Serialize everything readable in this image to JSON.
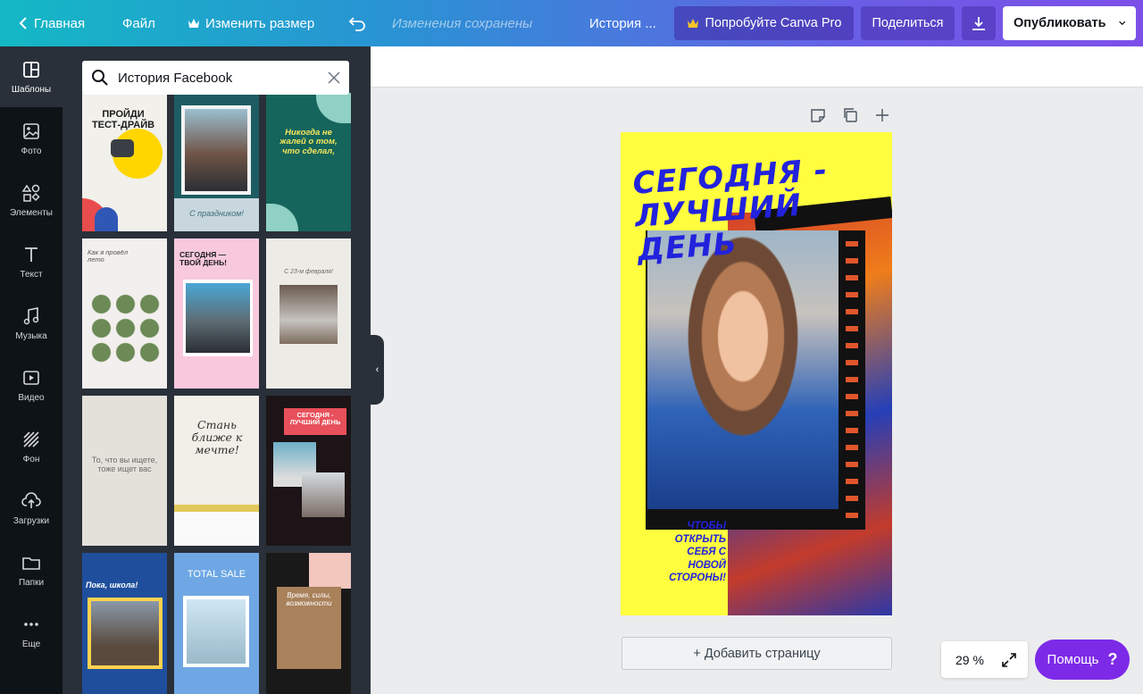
{
  "topbar": {
    "home_label": "Главная",
    "file_label": "Файл",
    "resize_label": "Изменить размер",
    "saved_status": "Изменения сохранены",
    "doc_title": "История ...",
    "pro_label": "Попробуйте Canva Pro",
    "share_label": "Поделиться",
    "publish_label": "Опубликовать"
  },
  "rail": {
    "items": [
      {
        "label": "Шаблоны",
        "icon": "templates-icon"
      },
      {
        "label": "Фото",
        "icon": "photo-icon"
      },
      {
        "label": "Элементы",
        "icon": "elements-icon"
      },
      {
        "label": "Текст",
        "icon": "text-icon"
      },
      {
        "label": "Музыка",
        "icon": "music-icon"
      },
      {
        "label": "Видео",
        "icon": "video-icon"
      },
      {
        "label": "Фон",
        "icon": "background-icon"
      },
      {
        "label": "Загрузки",
        "icon": "upload-icon"
      },
      {
        "label": "Папки",
        "icon": "folder-icon"
      },
      {
        "label": "Еще",
        "icon": "more-icon"
      }
    ]
  },
  "search": {
    "value": "История Facebook"
  },
  "templates": [
    {
      "text": "ПРОЙДИ ТЕСТ-ДРАЙВ"
    },
    {
      "text": "С праздником!"
    },
    {
      "text": "Никогда не жалей о том, что сделал,"
    },
    {
      "text": "Как я провёл лето"
    },
    {
      "text": "СЕГОДНЯ —ТВОЙ ДЕНЬ!"
    },
    {
      "text": "С 23-м февраля!"
    },
    {
      "text": "То, что вы ищете, тоже ищет вас"
    },
    {
      "text": "Стань ближе к мечте!"
    },
    {
      "text": "СЕГОДНЯ - ЛУЧШИЙ ДЕНЬ"
    },
    {
      "text": "Пока, школа!"
    },
    {
      "text": "TOTAL SALE"
    },
    {
      "text": "Время, силы, возможности"
    }
  ],
  "design": {
    "headline": "СЕГОДНЯ - ЛУЧШИЙ ДЕНЬ",
    "cta": "ЧТОБЫ ОТКРЫТЬ СЕБЯ С НОВОЙ СТОРОНЫ!"
  },
  "canvas": {
    "add_page_label": "+ Добавить страницу",
    "zoom_value": "29 %",
    "help_label": "Помощь",
    "help_mark": "?"
  },
  "colors": {
    "accent": "#7d2ae8",
    "design_bg": "#fefe3e",
    "design_text": "#2222dd"
  }
}
